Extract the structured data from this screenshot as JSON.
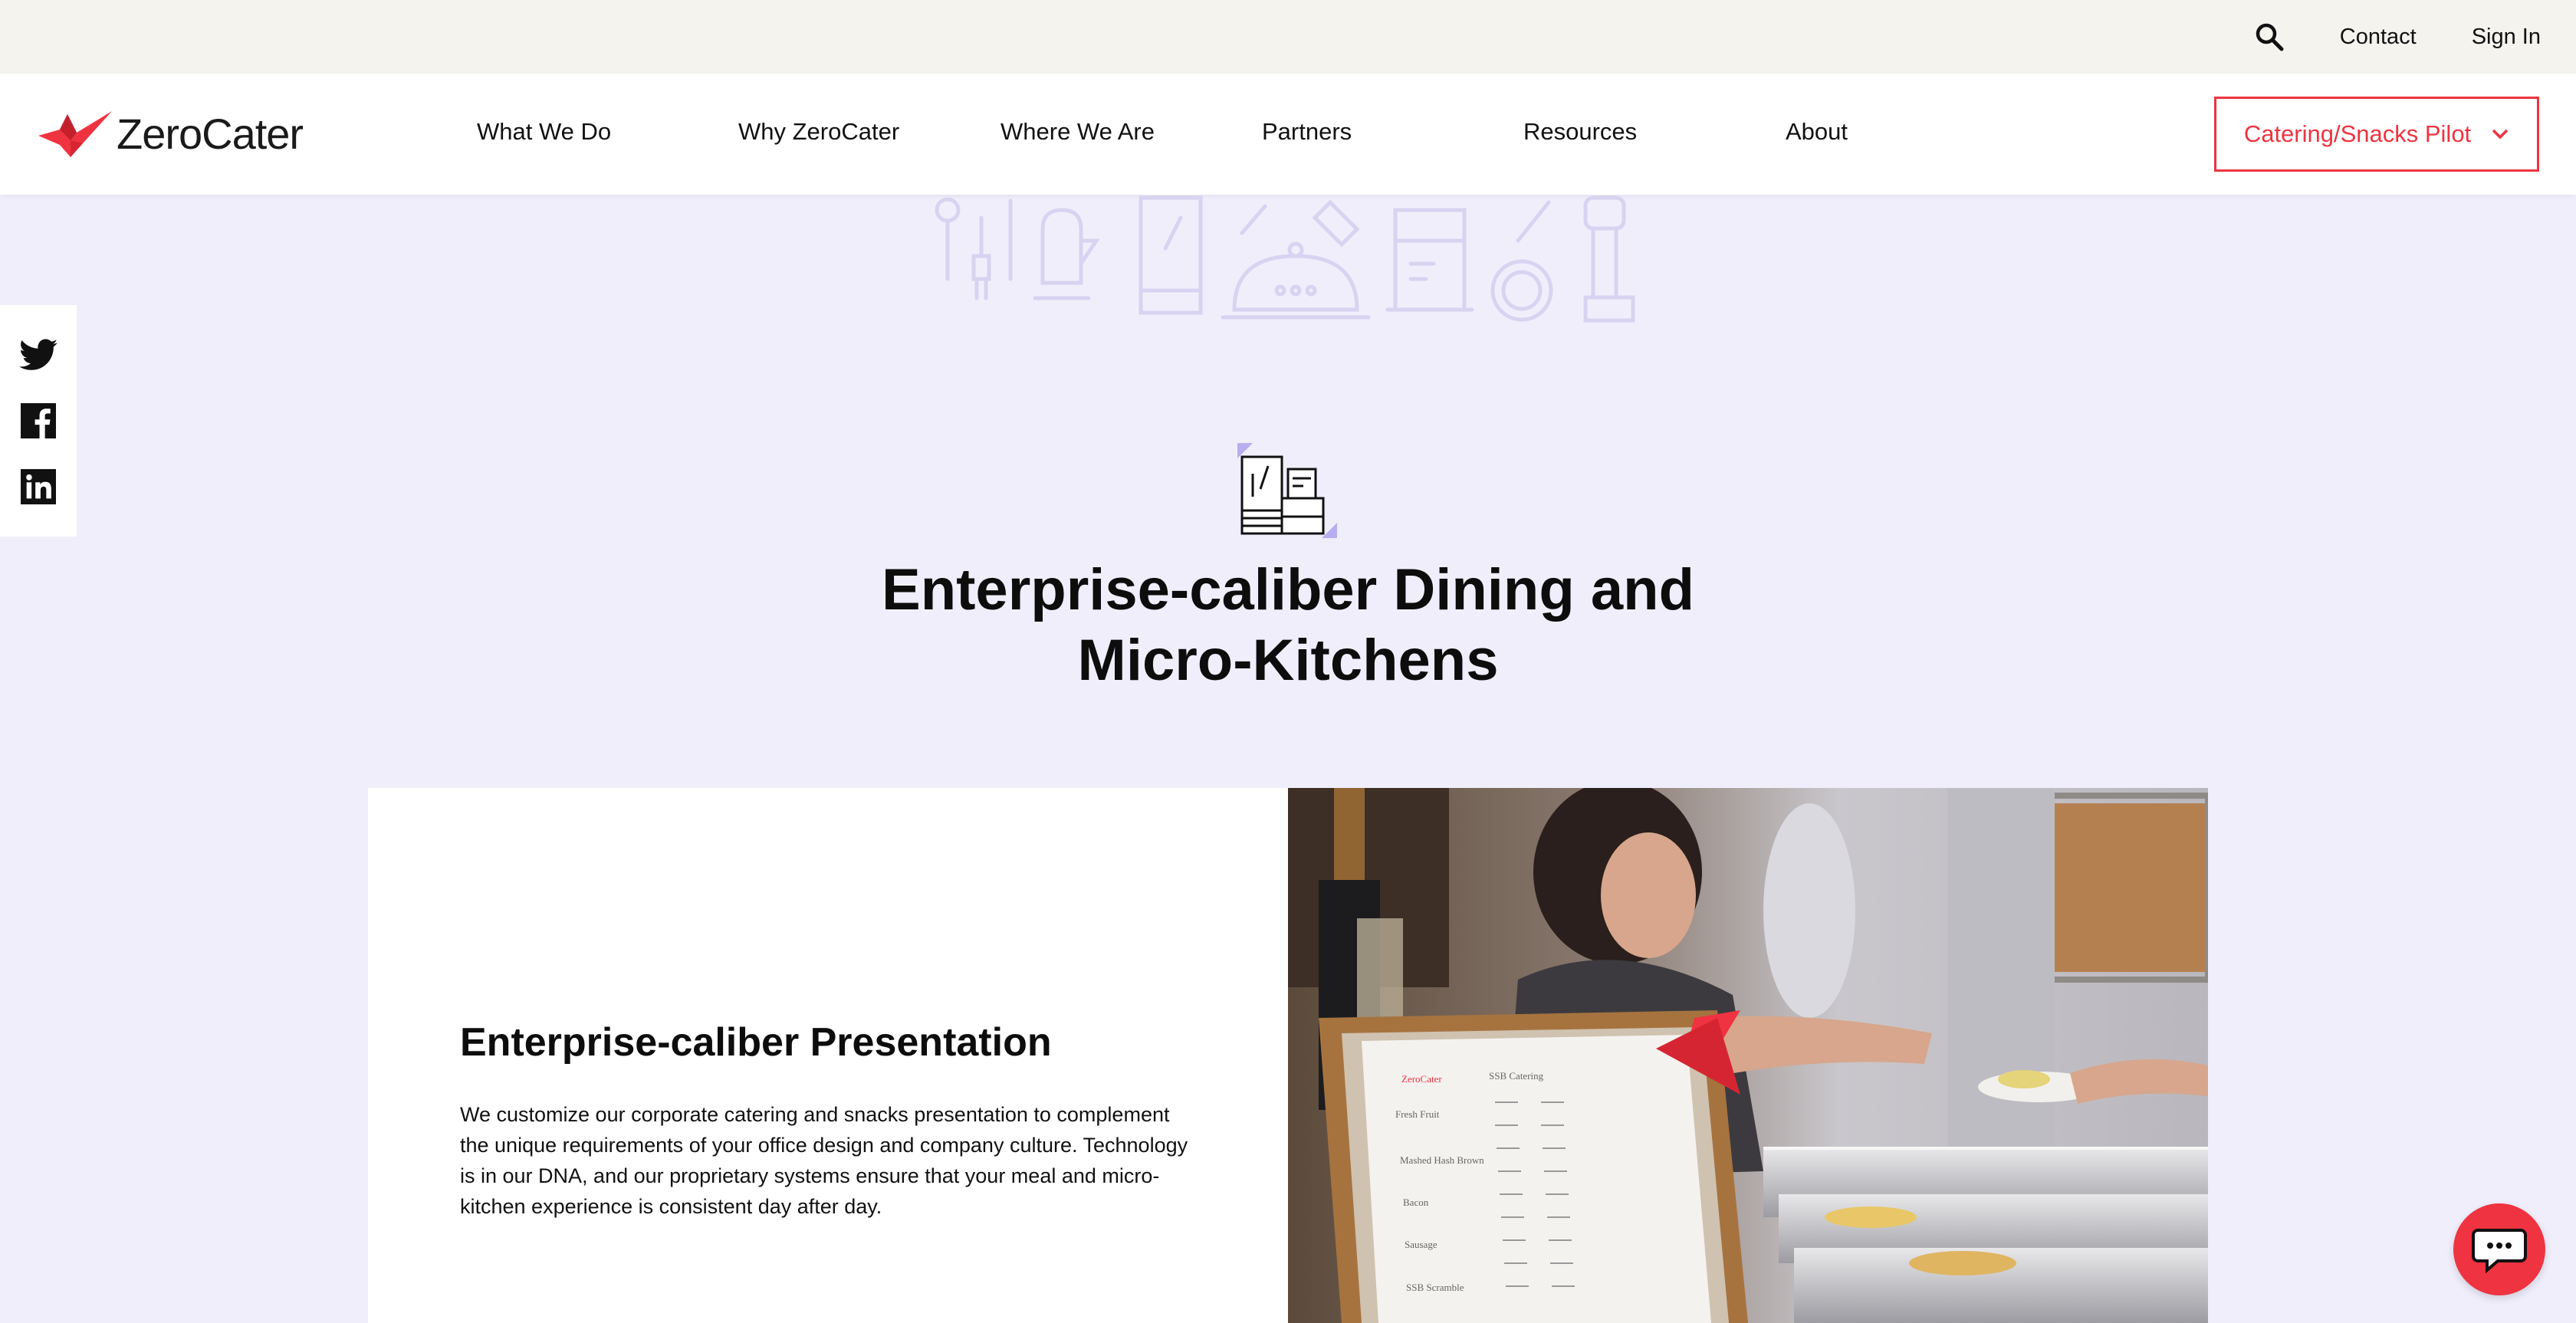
{
  "utility": {
    "contact_label": "Contact",
    "signin_label": "Sign In",
    "search_icon": "search-icon"
  },
  "brand": {
    "name": "ZeroCater",
    "accent": "#ef3340"
  },
  "nav": {
    "items": [
      {
        "label": "What We Do"
      },
      {
        "label": "Why ZeroCater"
      },
      {
        "label": "Where We Are"
      },
      {
        "label": "Partners"
      },
      {
        "label": "Resources"
      },
      {
        "label": "About"
      }
    ],
    "cta_label": "Catering/Snacks Pilot"
  },
  "social": {
    "icons": [
      "twitter-icon",
      "facebook-icon",
      "linkedin-icon"
    ]
  },
  "hero": {
    "title_line1": "Enterprise-caliber Dining and",
    "title_line2": "Micro-Kitchens"
  },
  "card": {
    "heading": "Enterprise-caliber Presentation",
    "body": "We customize our corporate catering and snacks presentation to complement the unique requirements of your office design and company culture. Technology is in our DNA, and our proprietary systems ensure that your meal and micro-kitchen experience is consistent day after day.",
    "menu_brand": "ZeroCater",
    "menu_heading": "SSB Catering",
    "menu_items": [
      "Fresh Fruit",
      "Mashed Hash Brown",
      "Bacon",
      "Sausage",
      "SSB Scramble"
    ]
  },
  "colors": {
    "page_bg": "#f1eefc",
    "utility_bg": "#f5f3ee",
    "accent": "#ef3340"
  }
}
